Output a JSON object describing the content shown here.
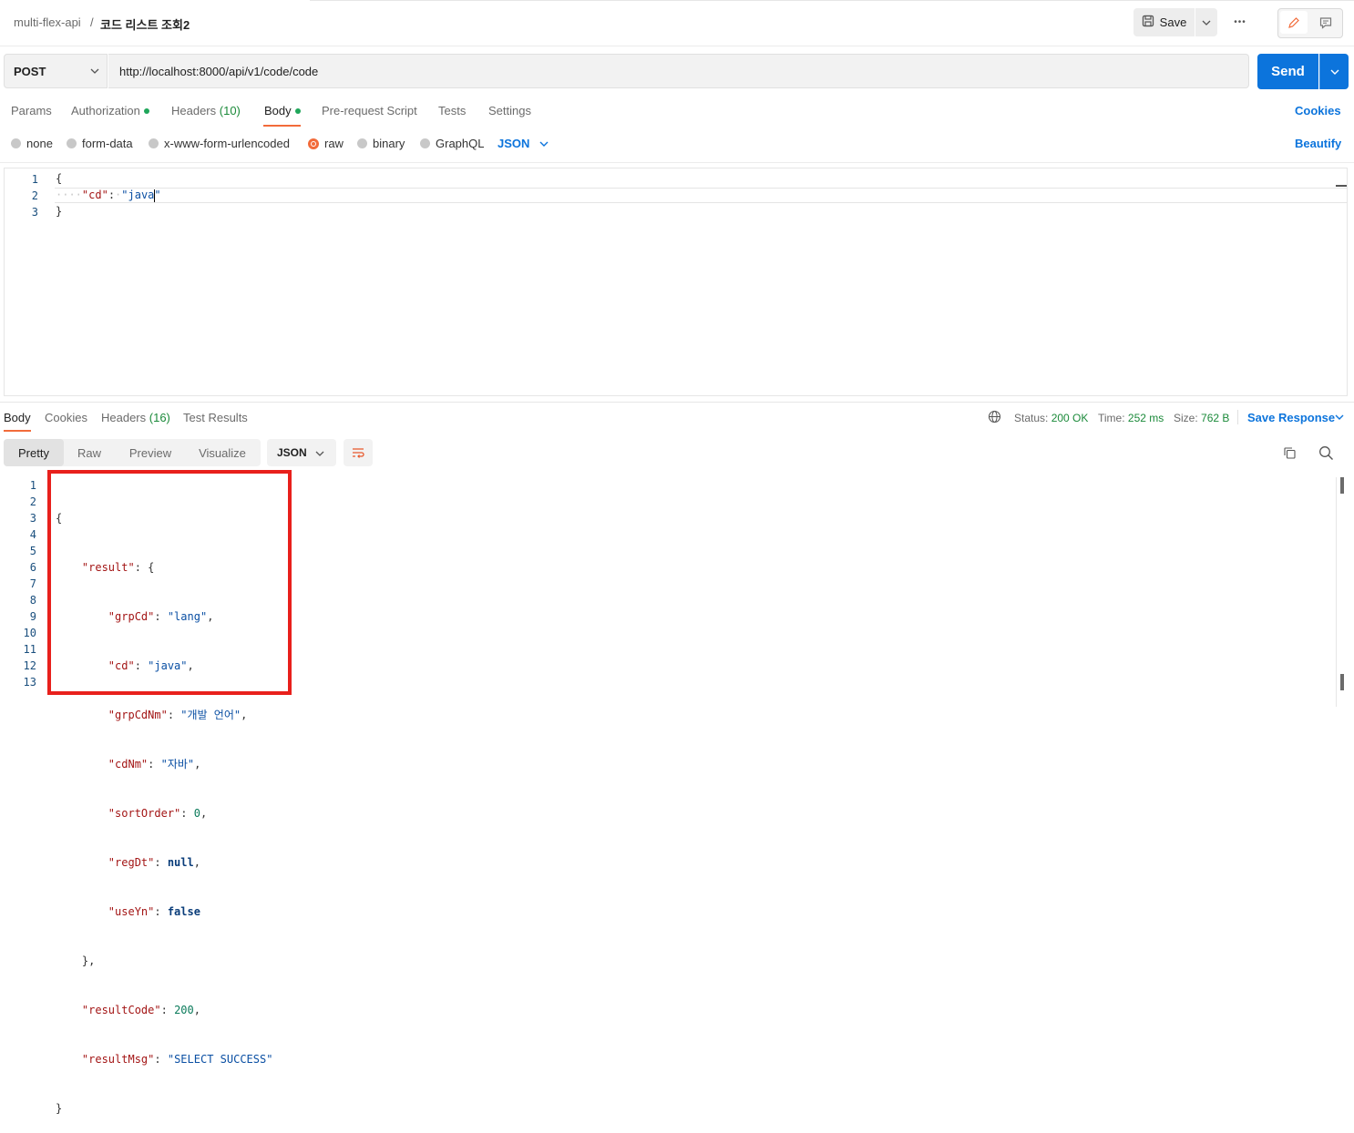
{
  "header": {
    "breadcrumb_parent": "multi-flex-api",
    "breadcrumb_sep": "/",
    "request_name": "코드 리스트 조회2",
    "save_label": "Save",
    "more_label": "•••"
  },
  "request": {
    "method": "POST",
    "url": "http://localhost:8000/api/v1/code/code",
    "send_label": "Send",
    "tabs": {
      "params": "Params",
      "authorization": "Authorization",
      "headers": "Headers",
      "headers_count": "(10)",
      "body": "Body",
      "prerequest": "Pre-request Script",
      "tests": "Tests",
      "settings": "Settings"
    },
    "cookies_label": "Cookies",
    "body_types": {
      "none": "none",
      "form_data": "form-data",
      "urlencoded": "x-www-form-urlencoded",
      "raw": "raw",
      "binary": "binary",
      "graphql": "GraphQL"
    },
    "body_format": "JSON",
    "beautify_label": "Beautify",
    "editor": {
      "line_numbers": [
        "1",
        "2",
        "3"
      ],
      "open_brace": "{",
      "indent": "····",
      "key": "\"cd\"",
      "colon": ":",
      "space": "·",
      "value": "\"java\"",
      "close_brace": "}"
    }
  },
  "response": {
    "tabs": {
      "body": "Body",
      "cookies": "Cookies",
      "headers": "Headers",
      "headers_count": "(16)",
      "test_results": "Test Results"
    },
    "status_label": "Status:",
    "status_value": "200 OK",
    "time_label": "Time:",
    "time_value": "252 ms",
    "size_label": "Size:",
    "size_value": "762 B",
    "save_response_label": "Save Response",
    "view_modes": {
      "pretty": "Pretty",
      "raw": "Raw",
      "preview": "Preview",
      "visualize": "Visualize"
    },
    "format": "JSON",
    "line_numbers": [
      "1",
      "2",
      "3",
      "4",
      "5",
      "6",
      "7",
      "8",
      "9",
      "10",
      "11",
      "12",
      "13"
    ],
    "json": {
      "l1": "{",
      "l2_key": "\"result\"",
      "l2_rest": ": {",
      "grpCd_key": "\"grpCd\"",
      "grpCd_val": "\"lang\"",
      "cd_key": "\"cd\"",
      "cd_val": "\"java\"",
      "grpCdNm_key": "\"grpCdNm\"",
      "grpCdNm_val": "\"개발 언어\"",
      "cdNm_key": "\"cdNm\"",
      "cdNm_val": "\"자바\"",
      "sortOrder_key": "\"sortOrder\"",
      "sortOrder_val": "0",
      "regDt_key": "\"regDt\"",
      "regDt_val": "null",
      "useYn_key": "\"useYn\"",
      "useYn_val": "false",
      "l10": "},",
      "resultCode_key": "\"resultCode\"",
      "resultCode_val": "200",
      "resultMsg_key": "\"resultMsg\"",
      "resultMsg_val": "\"SELECT SUCCESS\"",
      "l13": "}"
    }
  },
  "colors": {
    "accent": "#0c74dc",
    "tab_active": "#f26b3a",
    "status_ok": "#1b8a3a",
    "highlight": "#e8201c"
  }
}
